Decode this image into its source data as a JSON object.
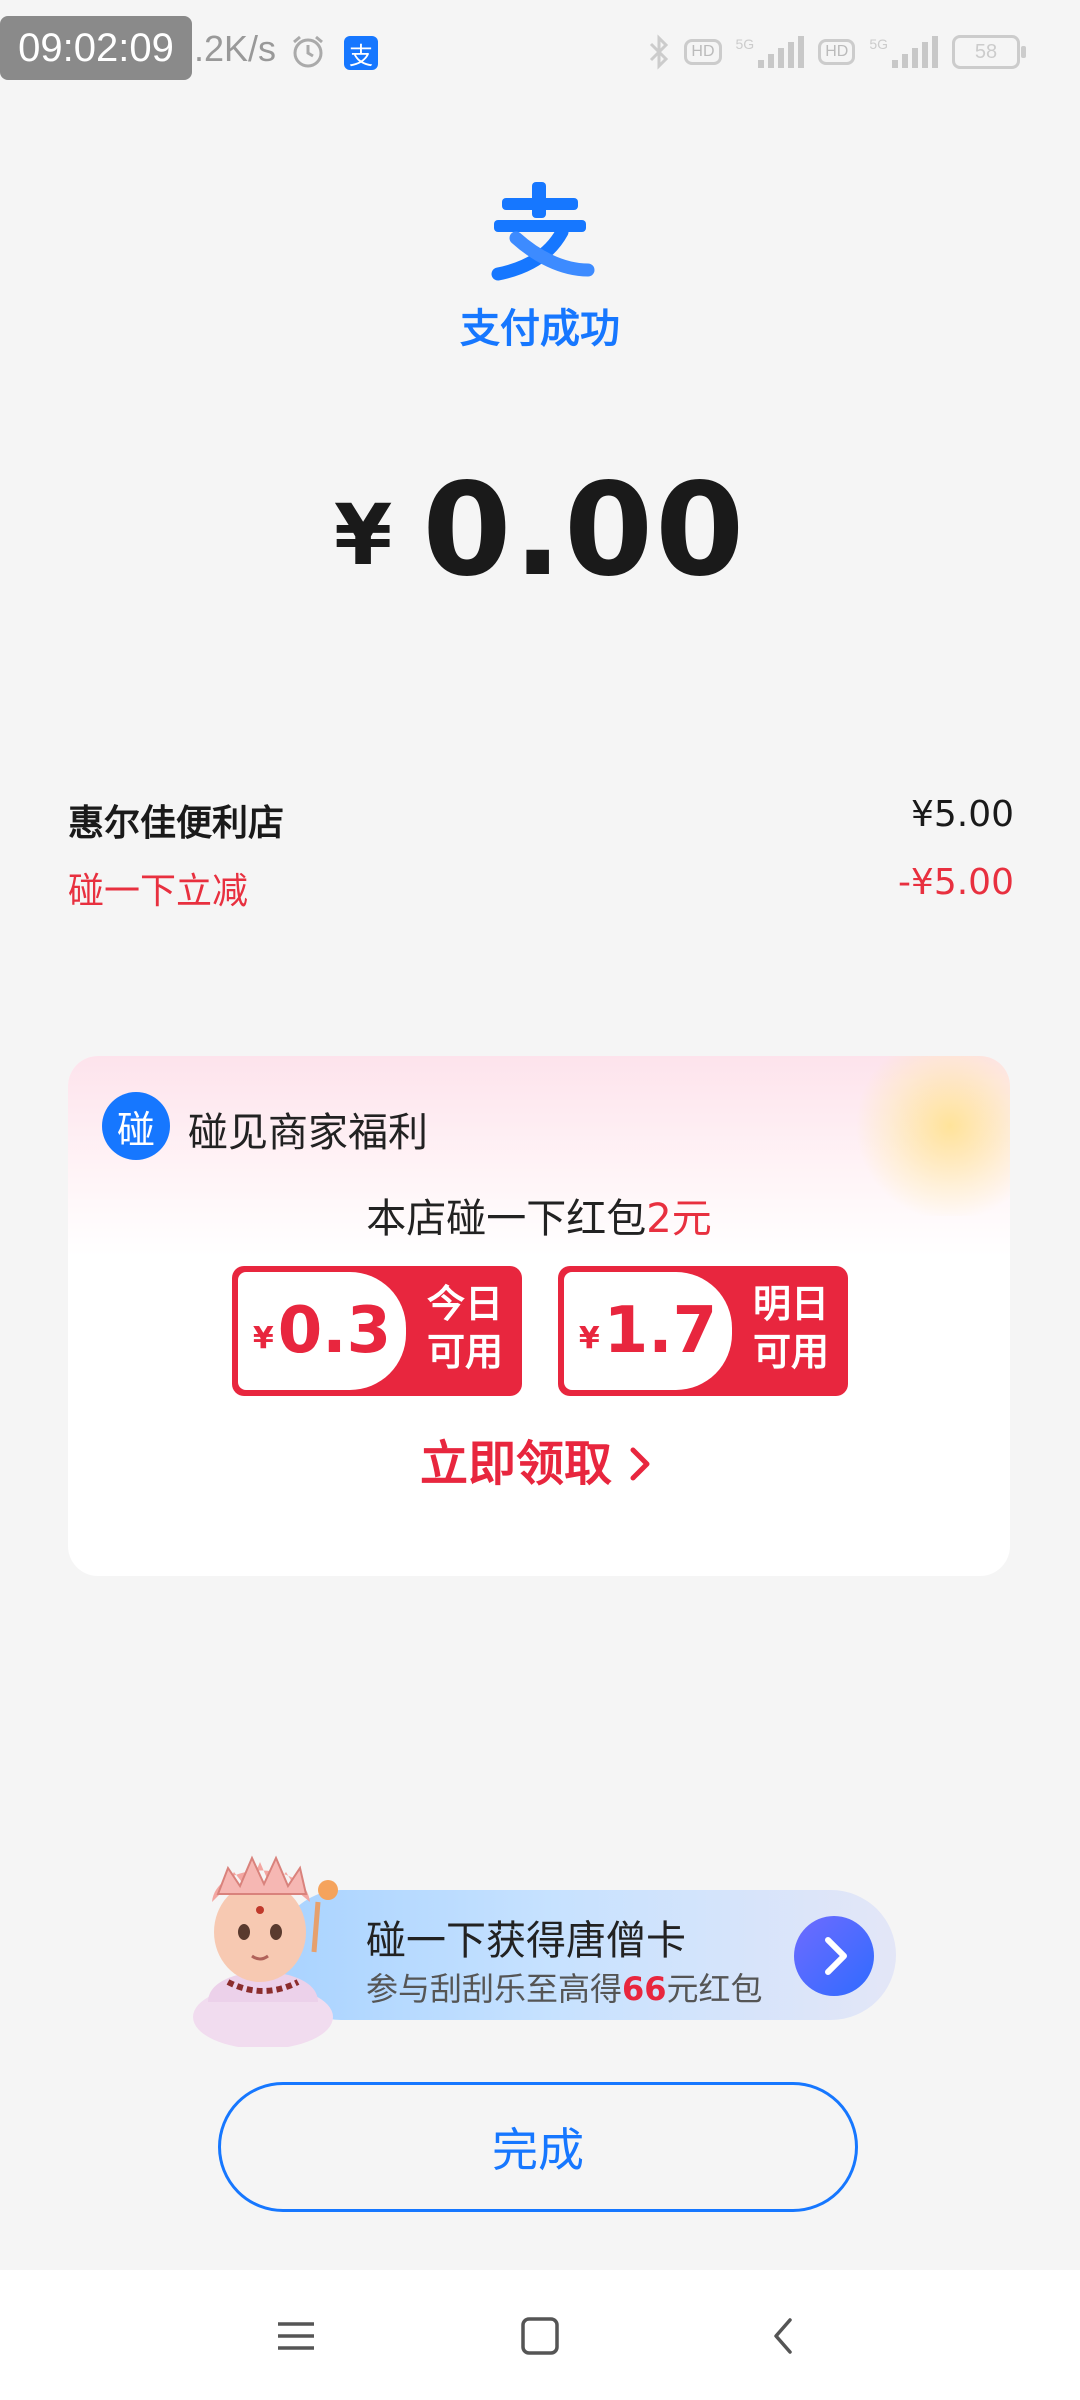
{
  "status_bar": {
    "time": "09:02:09",
    "net_speed": ".2K/s",
    "icons": [
      "alarm-icon",
      "alipay-icon",
      "bluetooth-icon",
      "hd-icon",
      "signal-5g-icon",
      "hd-icon",
      "signal-5g-icon",
      "battery-icon"
    ],
    "hd_label": "HD",
    "network_label": "5G",
    "battery": "58"
  },
  "header": {
    "logo_char": "支",
    "title": "支付成功"
  },
  "amount": {
    "currency": "¥",
    "value": "0.00"
  },
  "order": {
    "merchant_name": "惠尔佳便利店",
    "merchant_amount": "¥5.00",
    "discount_label": "碰一下立减",
    "discount_amount": "-¥5.00"
  },
  "benefit_card": {
    "icon_char": "碰",
    "title": "碰见商家福利",
    "subtitle_prefix": "本店碰一下红包",
    "subtitle_highlight": "2元",
    "coupons": [
      {
        "currency": "¥",
        "value": "0.3",
        "label_line1": "今日",
        "label_line2": "可用"
      },
      {
        "currency": "¥",
        "value": "1.7",
        "label_line1": "明日",
        "label_line2": "可用"
      }
    ],
    "claim_label": "立即领取"
  },
  "promo": {
    "title": "碰一下获得唐僧卡",
    "sub_prefix": "参与刮刮乐至高得",
    "sub_number": "66",
    "sub_suffix": "元红包"
  },
  "done_label": "完成",
  "colors": {
    "brand_blue": "#1677ff",
    "discount_red": "#e8303f",
    "coupon_red": "#e8263e",
    "background": "#f5f5f5"
  }
}
